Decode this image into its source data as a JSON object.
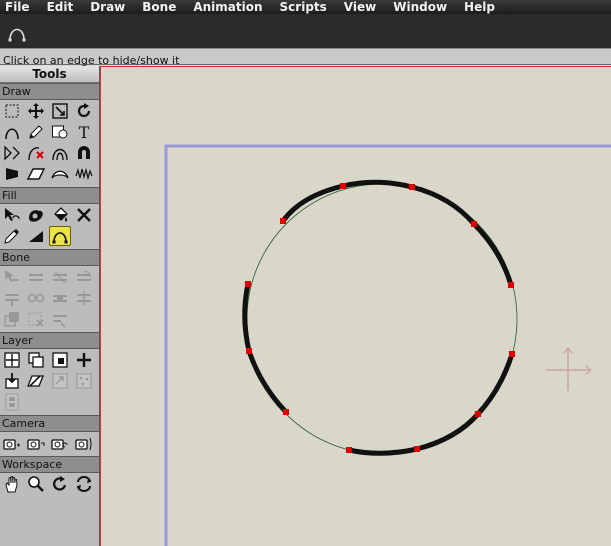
{
  "menu": [
    "File",
    "Edit",
    "Draw",
    "Bone",
    "Animation",
    "Scripts",
    "View",
    "Window",
    "Help"
  ],
  "tool_options_icon": "hide-edge-icon",
  "status": "Click on an edge to hide/show it",
  "toolbox": {
    "title": "Tools",
    "sections": {
      "draw": "Draw",
      "fill": "Fill",
      "bone": "Bone",
      "layer": "Layer",
      "camera": "Camera",
      "workspace": "Workspace"
    },
    "text_tool": "T"
  },
  "colors": {
    "menubar": "#222222",
    "active_tool": "#ede24a",
    "canvas": "#d9d7c9",
    "frame": "#9b97d8",
    "point": "#e00000",
    "stroke": "#111111",
    "origin_marker": "#c9a6a1",
    "canvas_border": "#d83030"
  }
}
